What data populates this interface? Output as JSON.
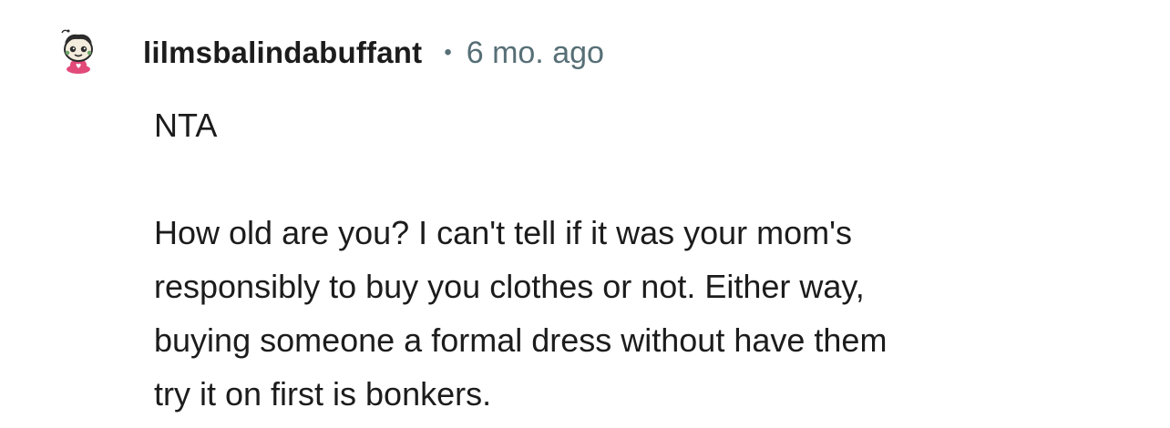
{
  "comment": {
    "author": "lilmsbalindabuffant",
    "separator": "•",
    "timestamp": "6 mo. ago",
    "verdict": "NTA",
    "body_lines": [
      "How old are you? I can't tell if it was your mom's",
      "responsibly to buy you clothes or not. Either way,",
      "buying someone a formal dress without have them",
      "try it on first is bonkers."
    ]
  },
  "avatar": {
    "icon": "user-avatar-icon",
    "colors": {
      "face": "#f4ecdc",
      "outline": "#2b2b2b",
      "accent": "#e24a7a",
      "cheek": "#6aa56b"
    }
  },
  "colors": {
    "text": "#1c1c1c",
    "meta": "#576f76",
    "background": "#ffffff"
  }
}
